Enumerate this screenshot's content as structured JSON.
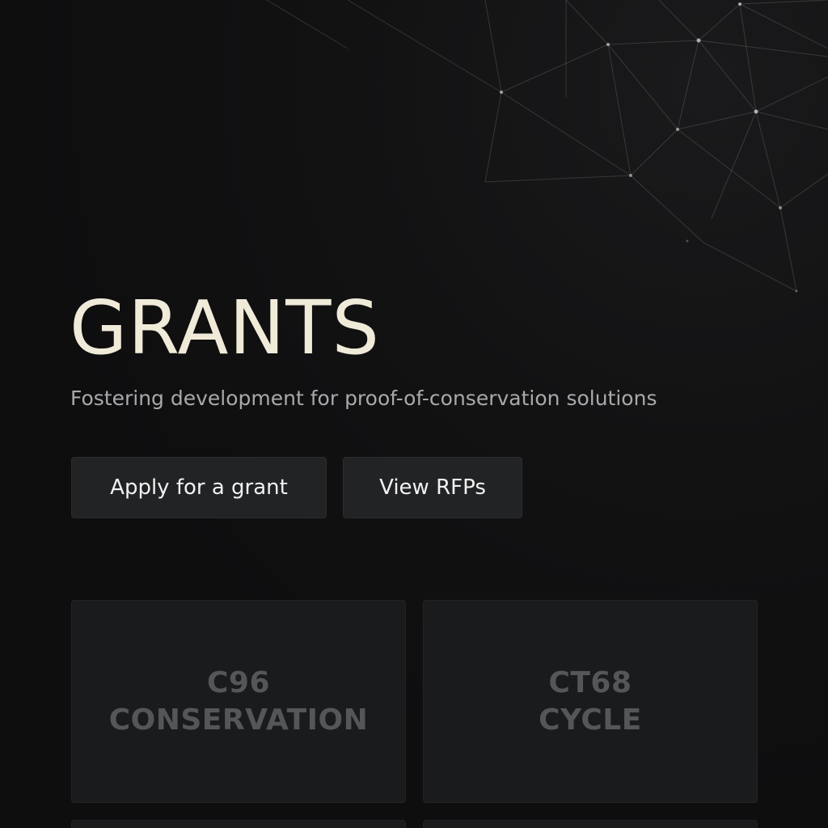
{
  "hero": {
    "title": "GRANTS",
    "subtitle": "Fostering development for proof-of-conservation solutions"
  },
  "actions": {
    "apply_label": "Apply for a grant",
    "rfps_label": "View RFPs"
  },
  "cards": [
    {
      "line1": "C96",
      "line2": "CONSERVATION"
    },
    {
      "line1": "CT68",
      "line2": "CYCLE"
    }
  ],
  "colors": {
    "background": "#0f0f10",
    "title": "#f0ead8",
    "subtitle": "#a9a9ac",
    "button_bg": "#222325",
    "card_bg": "#1a1b1d",
    "card_text": "#55565a"
  }
}
